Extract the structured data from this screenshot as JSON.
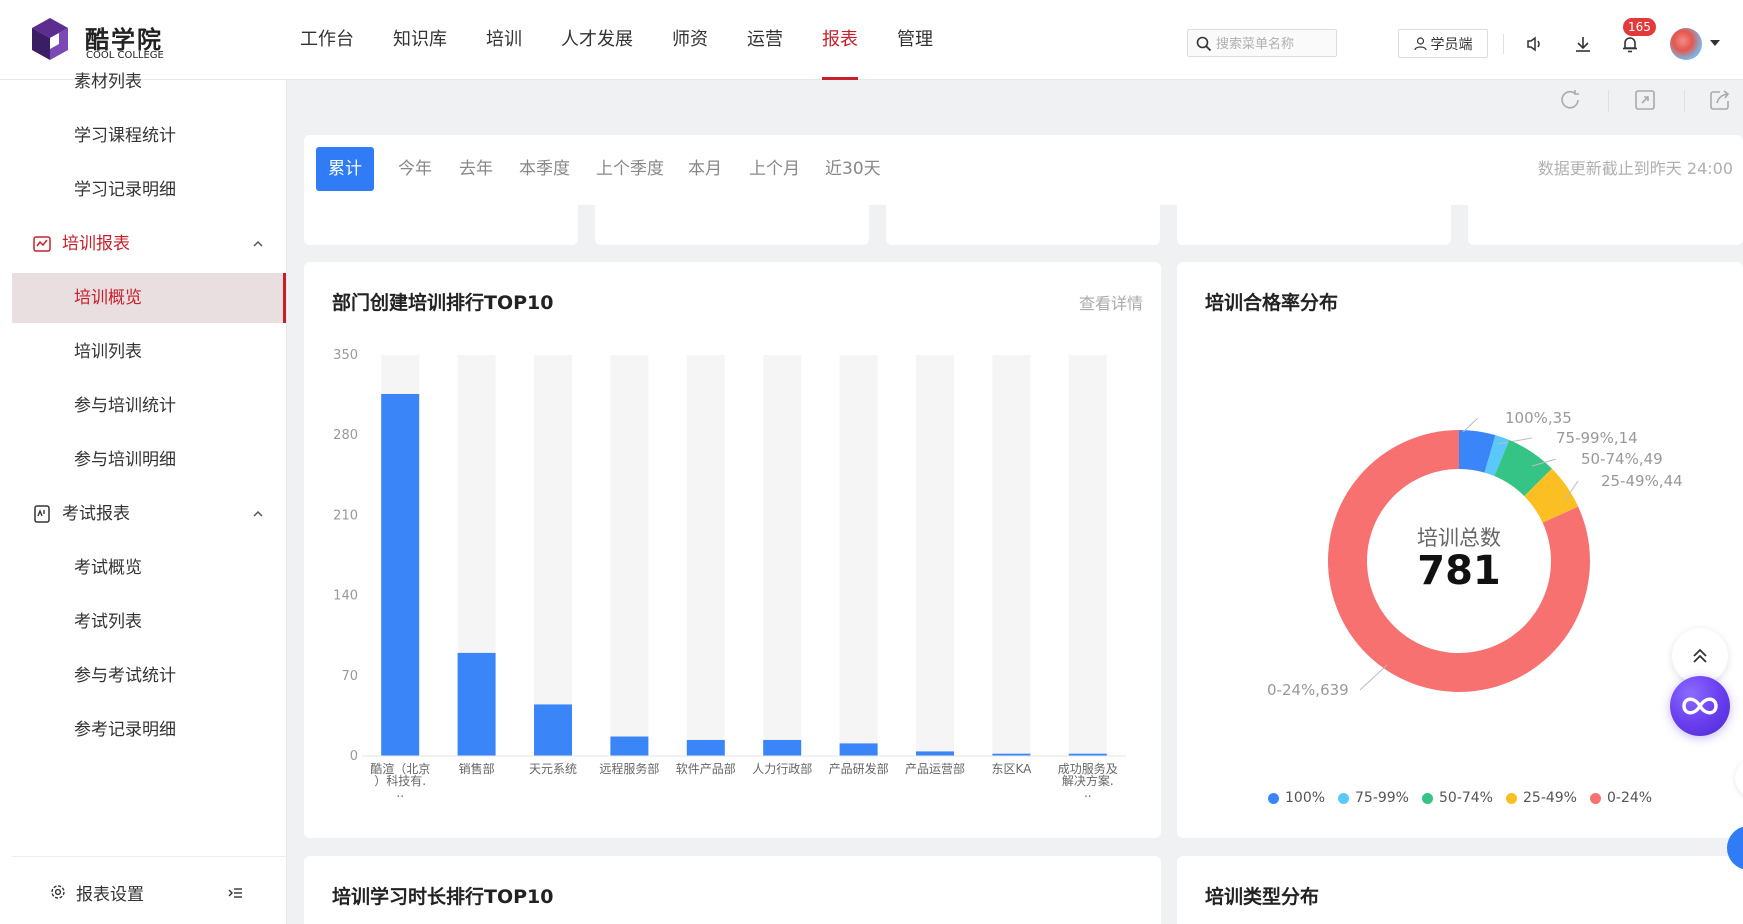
{
  "header": {
    "logo_cn": "酷学院",
    "logo_en": "COOL COLLEGE",
    "nav": [
      "工作台",
      "知识库",
      "培训",
      "人才发展",
      "师资",
      "运营",
      "报表",
      "管理"
    ],
    "active_nav": "报表",
    "search_placeholder": "搜索菜单名称",
    "student_button": "学员端",
    "notification_count": "165"
  },
  "sidebar": {
    "items": [
      {
        "label": "素材列表",
        "type": "item"
      },
      {
        "label": "学习课程统计",
        "type": "item"
      },
      {
        "label": "学习记录明细",
        "type": "item"
      },
      {
        "label": "培训报表",
        "type": "group",
        "icon": "line-chart-icon"
      },
      {
        "label": "培训概览",
        "type": "item",
        "selected": true
      },
      {
        "label": "培训列表",
        "type": "item"
      },
      {
        "label": "参与培训统计",
        "type": "item"
      },
      {
        "label": "参与培训明细",
        "type": "item"
      },
      {
        "label": "考试报表",
        "type": "group",
        "icon": "exam-report-icon"
      },
      {
        "label": "考试概览",
        "type": "item"
      },
      {
        "label": "考试列表",
        "type": "item"
      },
      {
        "label": "参与考试统计",
        "type": "item"
      },
      {
        "label": "参考记录明细",
        "type": "item"
      }
    ],
    "settings_label": "报表设置"
  },
  "filter": {
    "periods": [
      "累计",
      "今年",
      "去年",
      "本季度",
      "上个季度",
      "本月",
      "上个月",
      "近30天"
    ],
    "active_period": "累计",
    "update_note": "数据更新截止到昨天  24:00"
  },
  "cards": {
    "dept_rank_title": "部门创建培训排行TOP10",
    "dept_rank_link": "查看详情",
    "pass_rate_title": "培训合格率分布",
    "study_time_title": "培训学习时长排行TOP10",
    "type_dist_title": "培训类型分布",
    "donut_center_label": "培训总数",
    "donut_center_value": "781"
  },
  "colors": {
    "accent": "#c7202c",
    "primary_blue": "#2f7cf6",
    "bar": "#3a86f8",
    "bar_bg": "#f5f5f5"
  },
  "chart_data": [
    {
      "type": "bar",
      "title": "部门创建培训排行TOP10",
      "categories": [
        "酷渲（北京）科技有..",
        "销售部",
        "天元系统",
        "远程服务部",
        "软件产品部",
        "人力行政部",
        "产品研发部",
        "产品运营部",
        "东区KA",
        "成功服务及解决方案.."
      ],
      "category_lines": [
        [
          "酷渲（北京",
          "）科技有.",
          ".."
        ],
        [
          "销售部"
        ],
        [
          "天元系统"
        ],
        [
          "远程服务部"
        ],
        [
          "软件产品部"
        ],
        [
          "人力行政部"
        ],
        [
          "产品研发部"
        ],
        [
          "产品运营部"
        ],
        [
          "东区KA"
        ],
        [
          "成功服务及",
          "解决方案.",
          ".."
        ]
      ],
      "values": [
        316,
        90,
        45,
        17,
        14,
        14,
        11,
        4,
        2,
        2
      ],
      "yticks": [
        "0",
        "70",
        "140",
        "210",
        "280",
        "350"
      ],
      "ylim": [
        0,
        350
      ],
      "grid": false
    },
    {
      "type": "pie",
      "title": "培训合格率分布",
      "slices": [
        {
          "name": "100%",
          "value": 35,
          "label": "100%,35",
          "color": "#3a86f8"
        },
        {
          "name": "75-99%",
          "value": 14,
          "label": "75-99%,14",
          "color": "#5ac8fa"
        },
        {
          "name": "50-74%",
          "value": 49,
          "label": "50-74%,49",
          "color": "#35c486"
        },
        {
          "name": "25-49%",
          "value": 44,
          "label": "25-49%,44",
          "color": "#fbbf24"
        },
        {
          "name": "0-24%",
          "value": 639,
          "label": "0-24%,639",
          "color": "#f87171"
        }
      ],
      "legend_position": "bottom"
    }
  ]
}
